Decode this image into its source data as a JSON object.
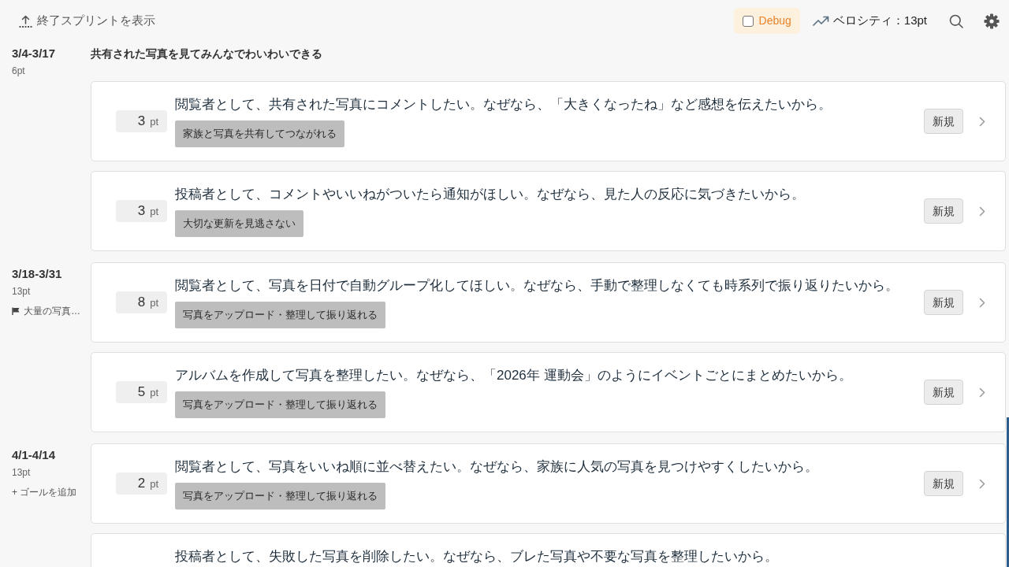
{
  "toolbar": {
    "show_finished": "終了スプリントを表示",
    "debug": {
      "label": "Debug",
      "checked": false
    },
    "velocity": "ベロシティ：13pt"
  },
  "sprints": [
    {
      "period": "3/4-3/17",
      "points": "6pt",
      "goal": {
        "kind": "heading",
        "label": "共有された写真を見てみんなでわいわいできる"
      },
      "stories": [
        {
          "points": "3",
          "unit": "pt",
          "text": "閲覧者として、共有された写真にコメントしたい。なぜなら、「大きくなったね」など感想を伝えたいから。",
          "epic": "家族と写真を共有してつながれる",
          "status": "新規"
        },
        {
          "points": "3",
          "unit": "pt",
          "text": "投稿者として、コメントやいいねがついたら通知がほしい。なぜなら、見た人の反応に気づきたいから。",
          "epic": "大切な更新を見逃さない",
          "status": "新規"
        }
      ]
    },
    {
      "period": "3/18-3/31",
      "points": "13pt",
      "goal": {
        "kind": "flag",
        "label": "大量の写真…"
      },
      "stories": [
        {
          "points": "8",
          "unit": "pt",
          "text": "閲覧者として、写真を日付で自動グループ化してほしい。なぜなら、手動で整理しなくても時系列で振り返りたいから。",
          "epic": "写真をアップロード・整理して振り返れる",
          "status": "新規"
        },
        {
          "points": "5",
          "unit": "pt",
          "text": "アルバムを作成して写真を整理したい。なぜなら、「2026年 運動会」のようにイベントごとにまとめたいから。",
          "epic": "写真をアップロード・整理して振り返れる",
          "status": "新規"
        }
      ]
    },
    {
      "period": "4/1-4/14",
      "points": "13pt",
      "goal": {
        "kind": "add",
        "label": "+ ゴールを追加"
      },
      "stories": [
        {
          "points": "2",
          "unit": "pt",
          "text": "閲覧者として、写真をいいね順に並べ替えたい。なぜなら、家族に人気の写真を見つけやすくしたいから。",
          "epic": "写真をアップロード・整理して振り返れる",
          "status": "新規"
        },
        {
          "text": "投稿者として、失敗した写真を削除したい。なぜなら、ブレた写真や不要な写真を整理したいから。"
        }
      ]
    }
  ]
}
